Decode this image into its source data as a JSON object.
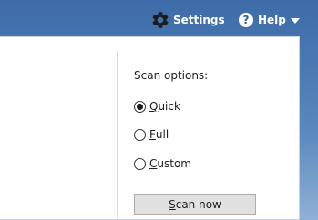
{
  "header": {
    "settings_label": "Settings",
    "settings_icon": "gear-icon",
    "help_label": "Help",
    "help_icon": "question-icon",
    "help_icon_glyph": "?"
  },
  "scan_options": {
    "title": "Scan options:",
    "selected": "Quick",
    "options": [
      {
        "access_key": "Q",
        "rest": "uick",
        "selected": true
      },
      {
        "access_key": "F",
        "rest": "ull",
        "selected": false
      },
      {
        "access_key": "C",
        "rest": "ustom",
        "selected": false
      }
    ],
    "scan_button": {
      "access_key": "S",
      "rest": "can now"
    }
  },
  "colors": {
    "header_bg": "#3d6ca8",
    "panel_bg": "#ffffff",
    "button_bg": "#e1e1e1"
  }
}
